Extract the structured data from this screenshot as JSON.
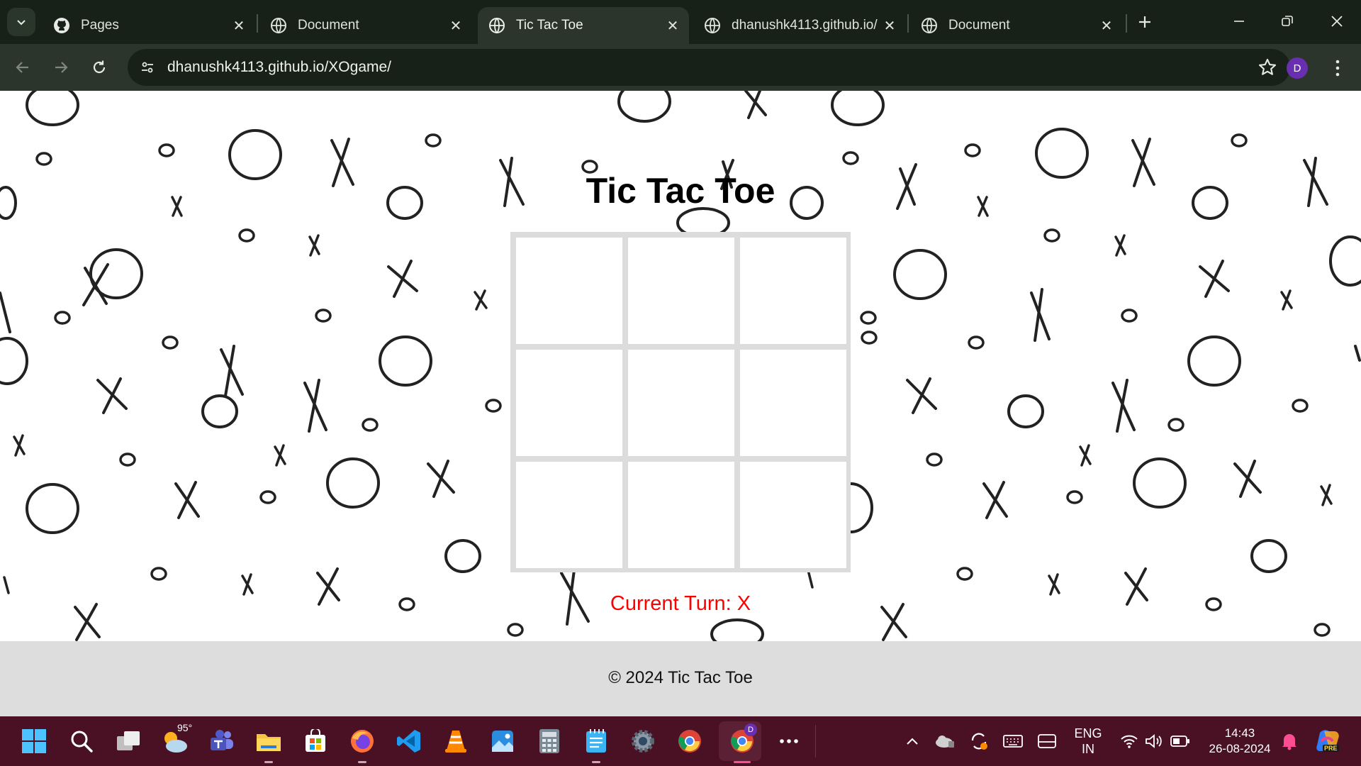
{
  "browser": {
    "tabs": [
      {
        "title": "Pages",
        "icon": "github-icon",
        "active": false
      },
      {
        "title": "Document",
        "icon": "globe-icon",
        "active": false
      },
      {
        "title": "Tic Tac Toe",
        "icon": "globe-icon",
        "active": true
      },
      {
        "title": "dhanushk4113.github.io/",
        "icon": "globe-icon",
        "active": false
      },
      {
        "title": "Document",
        "icon": "globe-icon",
        "active": false
      }
    ],
    "url": "dhanushk4113.github.io/XOgame/",
    "profile_initial": "D"
  },
  "page": {
    "title": "Tic Tac Toe",
    "board": [
      "",
      "",
      "",
      "",
      "",
      "",
      "",
      "",
      ""
    ],
    "current_turn": "Current Turn: X",
    "footer": "© 2024 Tic Tac Toe"
  },
  "taskbar": {
    "weather_temp": "95°",
    "chrome_profile_badge": "D",
    "lang_line1": "ENG",
    "lang_line2": "IN",
    "time": "14:43",
    "date": "26-08-2024",
    "copilot_badge": "PRE"
  },
  "colors": {
    "tabbar_bg": "#172117",
    "toolbar_bg": "#2b352b",
    "turn_text": "#ff0000",
    "footer_bg": "#dddddd",
    "taskbar_bg": "#4a1024"
  }
}
